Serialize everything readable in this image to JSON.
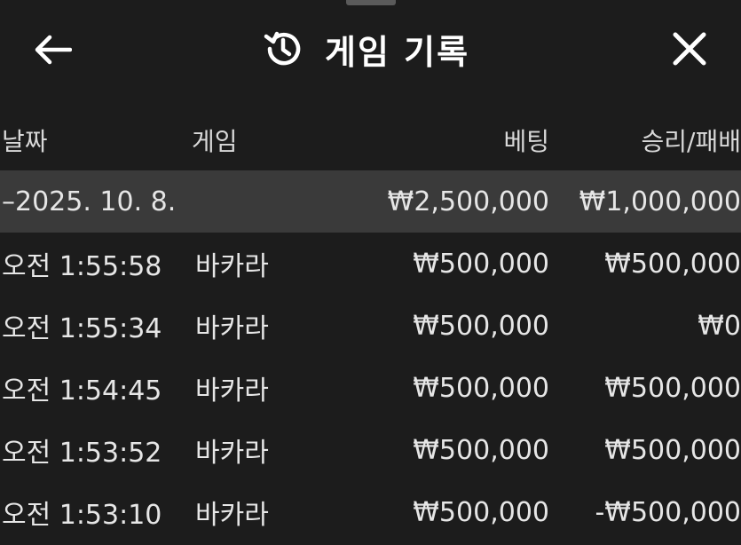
{
  "header": {
    "title": "게임 기록",
    "back_icon": "arrow-left-icon",
    "history_icon": "history-icon",
    "close_icon": "close-icon"
  },
  "colors": {
    "background": "#1c1c1c",
    "date_row_background": "#3a3a3a",
    "text": "#e6e6e6",
    "title": "#ffffff"
  },
  "table": {
    "columns": {
      "date": "날짜",
      "game": "게임",
      "bet": "베팅",
      "result": "승리/패배"
    },
    "group": {
      "date": "–2025. 10. 8.",
      "bet_total": "₩2,500,000",
      "result_total": "₩1,000,000"
    },
    "rows": [
      {
        "time": "오전 1:55:58",
        "game": "바카라",
        "bet": "₩500,000",
        "result": "₩500,000"
      },
      {
        "time": "오전 1:55:34",
        "game": "바카라",
        "bet": "₩500,000",
        "result": "₩0"
      },
      {
        "time": "오전 1:54:45",
        "game": "바카라",
        "bet": "₩500,000",
        "result": "₩500,000"
      },
      {
        "time": "오전 1:53:52",
        "game": "바카라",
        "bet": "₩500,000",
        "result": "₩500,000"
      },
      {
        "time": "오전 1:53:10",
        "game": "바카라",
        "bet": "₩500,000",
        "result": "-₩500,000"
      }
    ]
  }
}
